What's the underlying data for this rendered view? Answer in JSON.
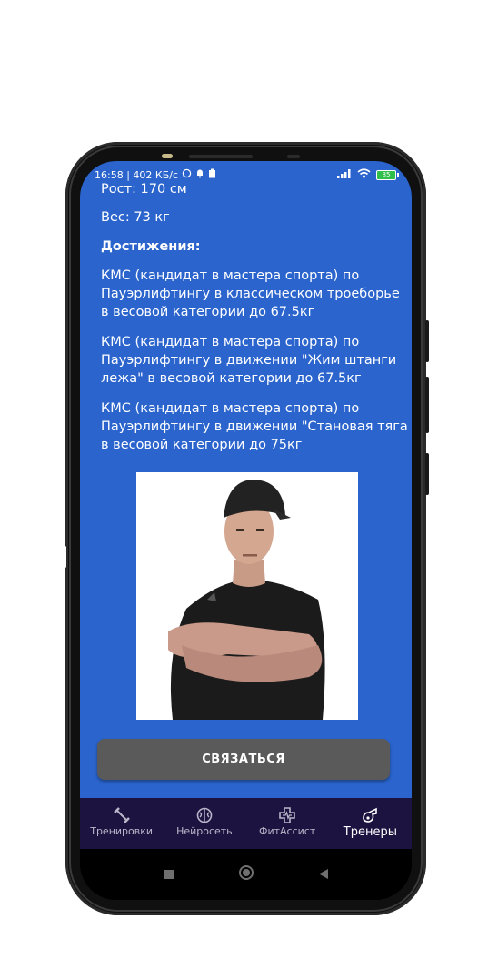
{
  "status_bar": {
    "time_info": "16:58 | 402 КБ/с",
    "battery": "85"
  },
  "profile": {
    "height_text": "Рост: 170 см",
    "weight_text": "Вес: 73 кг",
    "achievements_heading": "Достижения:",
    "achievements": [
      [
        "КМС (кандидат в мастера спорта) по",
        "Пауэрлифтингу в классическом троеборье",
        "в весовой категории до 67.5кг"
      ],
      [
        "КМС (кандидат в мастера спорта) по",
        "Пауэрлифтингу в движении \"Жим штанги",
        "лежа\" в весовой категории до 67.5кг"
      ],
      [
        "КМС (кандидат в мастера спорта) по",
        "Пауэрлифтингу в движении \"Становая тяга",
        "в весовой категории до 75кг"
      ]
    ]
  },
  "contact_button": "СВЯЗАТЬСЯ",
  "bottom_nav": {
    "items": [
      {
        "label": "Тренировки",
        "icon": "dumbbell-icon"
      },
      {
        "label": "Нейросеть",
        "icon": "brain-icon"
      },
      {
        "label": "ФитАссист",
        "icon": "medical-cross-icon"
      },
      {
        "label": "Тренеры",
        "icon": "whistle-icon"
      }
    ],
    "active_index": 3
  },
  "colors": {
    "content_bg": "#2a64cc",
    "nav_bg": "#1d1340",
    "button_bg": "#5a5a5a"
  }
}
